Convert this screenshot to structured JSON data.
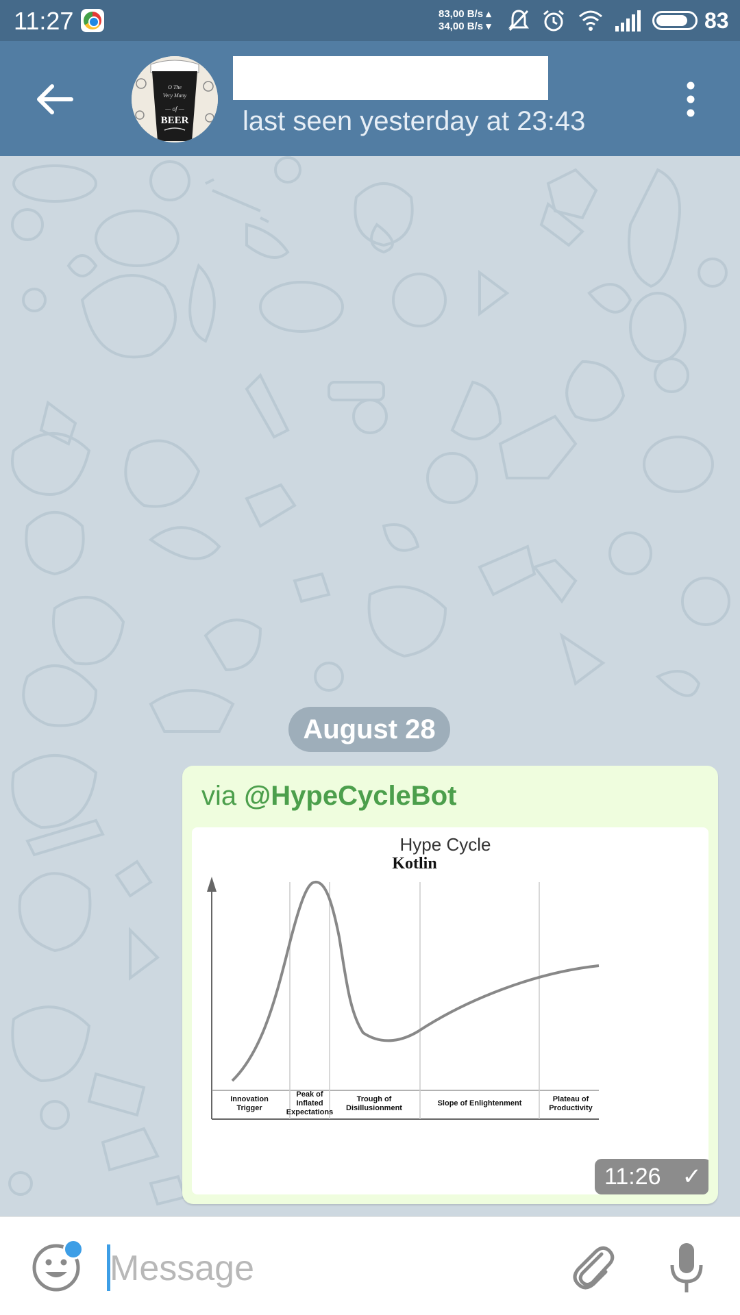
{
  "status_bar": {
    "time": "11:27",
    "speed_up": "83,00 B/s ▴",
    "speed_down": "34,00 B/s ▾",
    "battery_level": 83,
    "battery_text": "83",
    "icons": [
      "chrome-icon",
      "mute-vibrate-icon",
      "alarm-icon",
      "wifi-icon",
      "signal-icon",
      "battery-icon"
    ]
  },
  "header": {
    "contact_name": "",
    "last_seen": "last seen yesterday at 23:43",
    "avatar_text": "BEER"
  },
  "chat": {
    "date_separator": "August 28",
    "message": {
      "via_prefix": "via ",
      "via_bot": "@HypeCycleBot",
      "time": "11:26",
      "status": "✓",
      "image": {
        "title": "Hype Cycle",
        "subtitle": "Kotlin",
        "phases": [
          [
            "Innovation",
            "Trigger"
          ],
          [
            "Peak of",
            "Inflated",
            "Expectations"
          ],
          [
            "Trough of",
            "Disillusionment"
          ],
          [
            "Slope of Enlightenment"
          ],
          [
            "Plateau of",
            "Productivity"
          ]
        ]
      }
    }
  },
  "input_bar": {
    "placeholder": "Message"
  },
  "colors": {
    "status_bar": "#456a8a",
    "app_bar": "#527da3",
    "chat_bg": "#cdd8e0",
    "bubble": "#effdde",
    "via_text": "#4c9f4c",
    "accent": "#3d9ee6"
  }
}
